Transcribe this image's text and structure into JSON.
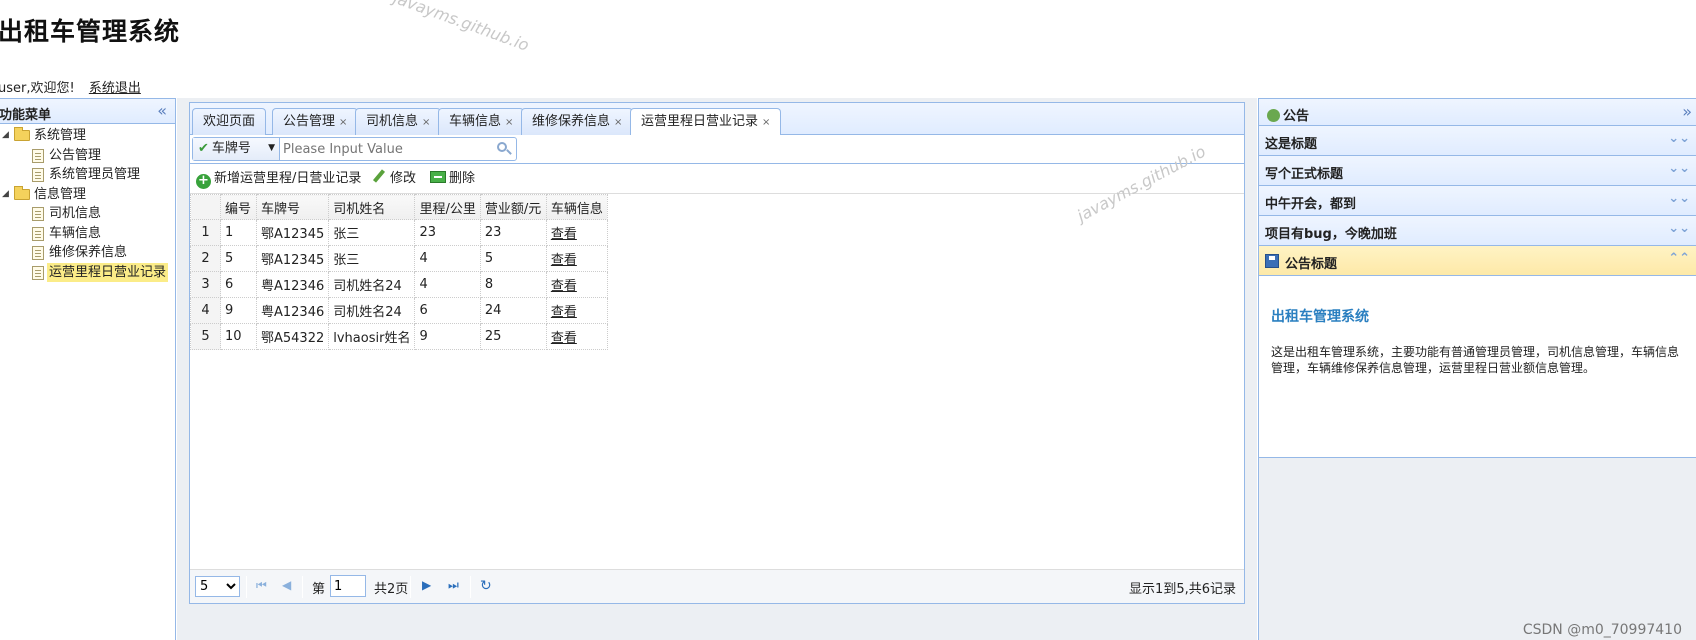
{
  "header": {
    "title": "出租车管理系统",
    "welcome": "user,欢迎您!",
    "logout": "系统退出",
    "watermark": "javayms.github.io"
  },
  "left_panel": {
    "title": "功能菜单",
    "collapse_icon": "double-chevron-left-icon",
    "tree": [
      {
        "label": "系统管理",
        "type": "folder"
      },
      {
        "label": "公告管理",
        "type": "file"
      },
      {
        "label": "系统管理员管理",
        "type": "file"
      },
      {
        "label": "信息管理",
        "type": "folder"
      },
      {
        "label": "司机信息",
        "type": "file"
      },
      {
        "label": "车辆信息",
        "type": "file"
      },
      {
        "label": "维修保养信息",
        "type": "file"
      },
      {
        "label": "运营里程日营业记录",
        "type": "file",
        "selected": true
      }
    ]
  },
  "tabs": [
    {
      "label": "欢迎页面",
      "closable": false
    },
    {
      "label": "公告管理",
      "closable": true
    },
    {
      "label": "司机信息",
      "closable": true
    },
    {
      "label": "车辆信息",
      "closable": true
    },
    {
      "label": "维修保养信息",
      "closable": true
    },
    {
      "label": "运营里程日营业记录",
      "closable": true,
      "active": true
    }
  ],
  "tab_close_glyph": "×",
  "search": {
    "field": "车牌号",
    "placeholder": "Please Input Value"
  },
  "toolbar": {
    "add_label": "新增运营里程/日营业记录",
    "edit_label": "修改",
    "delete_label": "删除"
  },
  "table": {
    "columns": [
      "编号",
      "车牌号",
      "司机姓名",
      "里程/公里",
      "营业额/元",
      "车辆信息"
    ],
    "rows": [
      {
        "rn": "1",
        "id": "1",
        "plate": "鄂A12345",
        "driver": "张三",
        "km": "23",
        "revenue": "23",
        "link": "查看"
      },
      {
        "rn": "2",
        "id": "5",
        "plate": "鄂A12345",
        "driver": "张三",
        "km": "4",
        "revenue": "5",
        "link": "查看"
      },
      {
        "rn": "3",
        "id": "6",
        "plate": "粤A12346",
        "driver": "司机姓名24",
        "km": "4",
        "revenue": "8",
        "link": "查看"
      },
      {
        "rn": "4",
        "id": "9",
        "plate": "粤A12346",
        "driver": "司机姓名24",
        "km": "6",
        "revenue": "24",
        "link": "查看"
      },
      {
        "rn": "5",
        "id": "10",
        "plate": "鄂A54322",
        "driver": "lvhaosir姓名",
        "km": "9",
        "revenue": "25",
        "link": "查看"
      }
    ]
  },
  "pager": {
    "page_size": "5",
    "page_size_options": [
      "5"
    ],
    "page_prefix": "第",
    "page_value": "1",
    "page_total": "共2页",
    "info": "显示1到5,共6记录"
  },
  "right_panel": {
    "title": "公告",
    "expand_icon": "double-chevron-right-icon",
    "items": [
      {
        "title": "这是标题",
        "open": false
      },
      {
        "title": "写个正式标题",
        "open": false
      },
      {
        "title": "中午开会，都到",
        "open": false
      },
      {
        "title": "项目有bug，今晚加班",
        "open": false
      },
      {
        "title": "公告标题",
        "open": true
      }
    ],
    "content_title": "出租车管理系统",
    "content_text": "这是出租车管理系统，主要功能有普通管理员管理，司机信息管理，车辆信息管理，车辆维修保养信息管理，运营里程日营业额信息管理。"
  },
  "footer_watermark": "CSDN @m0_70997410",
  "colors": {
    "border": "#95b8e7",
    "header_gradient_top": "#eff5ff",
    "header_gradient_bottom": "#e0ecff",
    "selected": "#fbec88",
    "accordion_open": "#fde9a8",
    "link_title": "#2a7fc0"
  }
}
